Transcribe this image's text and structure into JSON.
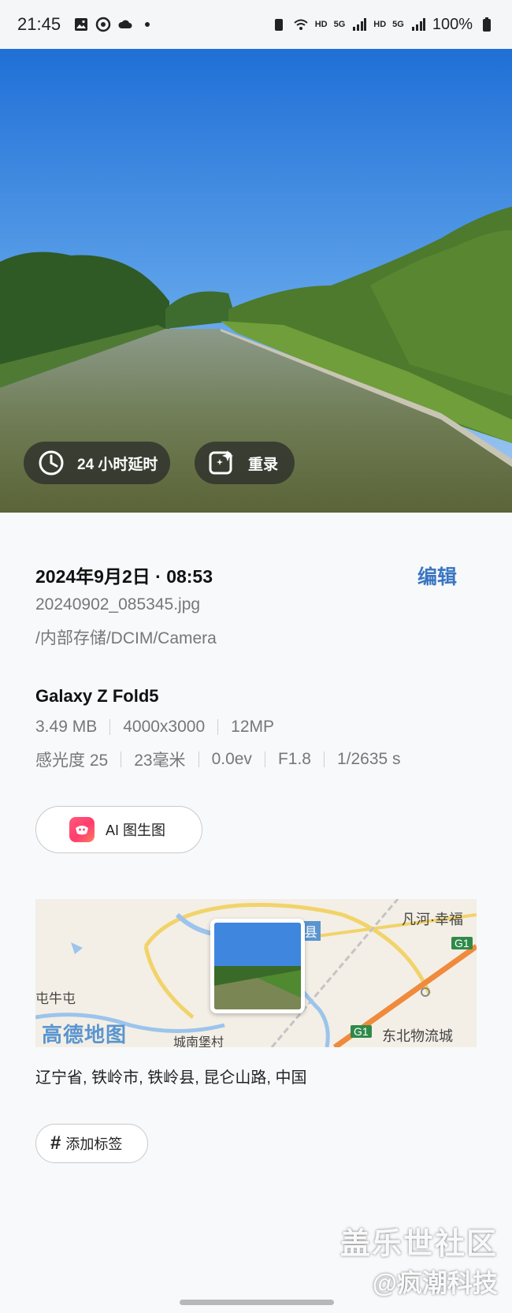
{
  "status_bar": {
    "time": "21:45",
    "hd1": "HD",
    "sig1": "5G",
    "hd2": "HD",
    "sig2": "5G",
    "battery": "100%"
  },
  "photo": {
    "chip_timer_label": "24 小时延时",
    "chip_remaster_label": "重录"
  },
  "details": {
    "date_time": "2024年9月2日 · 08:53",
    "edit_label": "编辑",
    "filename": "20240902_085345.jpg",
    "path": "/内部存储/DCIM/Camera",
    "device": "Galaxy Z Fold5",
    "specs_row1": [
      "3.49 MB",
      "4000x3000",
      "12MP"
    ],
    "specs_row2": [
      "感光度 25",
      "23毫米",
      "0.0ev",
      "F1.8",
      "1/2635 s"
    ]
  },
  "ai_button_label": "AI 图生图",
  "map": {
    "county_label": "岭县",
    "top_right_label": "凡河·幸福",
    "left_label": "屯牛屯",
    "bottom_label": "城南堡村",
    "logistics_label": "东北物流城",
    "highway_label": "G1",
    "highway_label_right": "G1",
    "brand_label": "高德地图"
  },
  "address": "辽宁省, 铁岭市, 铁岭县, 昆仑山路, 中国",
  "tag_button_label": "添加标签",
  "watermark": {
    "line1": "盖乐世社区",
    "line2": "@疯潮科技"
  }
}
